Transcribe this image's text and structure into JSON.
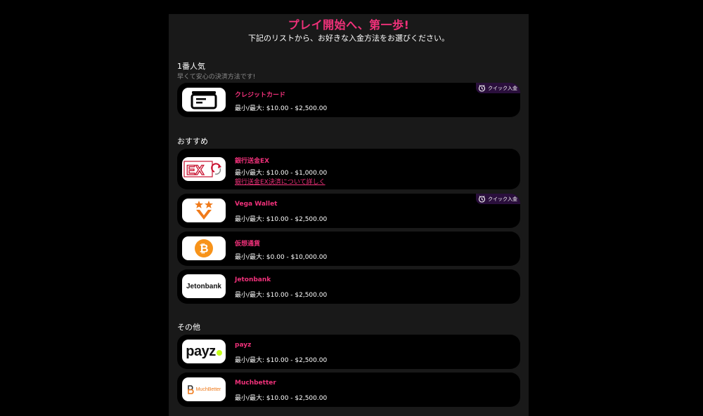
{
  "header": {
    "title": "プレイ開始へ、第一歩!",
    "subtitle": "下記のリストから、お好きな入金方法をお選びください。"
  },
  "quick_deposit_label": "クイック入金",
  "sections": {
    "popular": {
      "label": "1番人気",
      "sublabel": "早くて安心の決済方法です!",
      "methods": [
        {
          "name": "クレジットカード",
          "limits": "最小/最大: $10.00 - $2,500.00",
          "quick": true,
          "logo": "credit-card-icon"
        }
      ]
    },
    "recommended": {
      "label": "おすすめ",
      "methods": [
        {
          "name": "銀行送金EX",
          "limits": "最小/最大: $10.00 - $1,000.00",
          "link": "銀行送金EX決済について詳しく",
          "logo": "ex-bank-transfer-logo"
        },
        {
          "name": "Vega Wallet",
          "limits": "最小/最大: $10.00 - $2,500.00",
          "quick": true,
          "logo": "vega-wallet-logo"
        },
        {
          "name": "仮想通貨",
          "limits": "最小/最大: $0.00 - $10,000.00",
          "logo": "bitcoin-icon"
        },
        {
          "name": "Jetonbank",
          "limits": "最小/最大: $10.00 - $2,500.00",
          "logo_text": "Jetonbank"
        }
      ]
    },
    "other": {
      "label": "その他",
      "methods": [
        {
          "name": "payz",
          "limits": "最小/最大: $10.00 - $2,500.00",
          "logo_text": "payz"
        },
        {
          "name": "Muchbetter",
          "limits": "最小/最大: $10.00 - $2,500.00",
          "logo_text": "MuchBetter"
        }
      ]
    }
  },
  "colors": {
    "accent": "#f0317a",
    "panel": "#191919",
    "card": "#000000",
    "quick_badge": "#2a0f3c",
    "bitcoin": "#f7931a",
    "vega": "#f07a1a"
  }
}
